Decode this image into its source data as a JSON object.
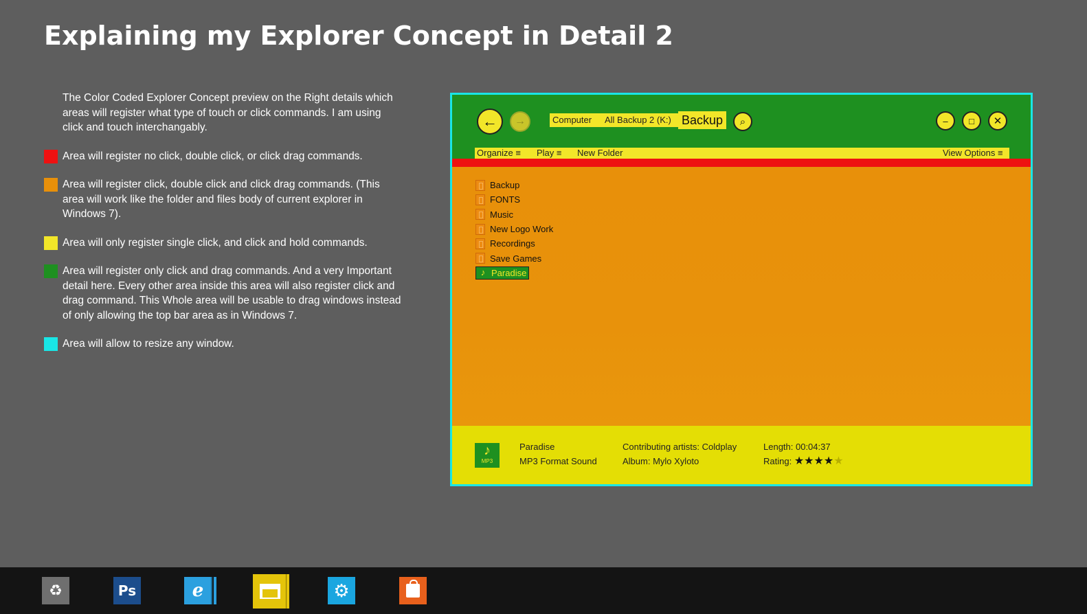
{
  "page": {
    "title": "Explaining my Explorer Concept in Detail 2"
  },
  "explanation": {
    "intro": "The Color Coded Explorer Concept preview on the Right details which areas will register what type of touch or click commands. I am using click and touch interchangably.",
    "legend": [
      {
        "color": "#ee1111",
        "text": "Area will register no click, double click, or click drag commands."
      },
      {
        "color": "#e8900a",
        "text": "Area will register click, double click and click drag commands. (This area will work like the folder and files body of current explorer in Windows 7)."
      },
      {
        "color": "#f2e629",
        "text": "Area will only register single click, and click and hold commands."
      },
      {
        "color": "#1e9020",
        "text": "Area will register only click and drag commands. And a very Important detail here. Every other area inside this area will also register click and drag command. This Whole area will be usable to drag windows instead of only allowing the top bar area as in Windows 7."
      },
      {
        "color": "#19e6e6",
        "text": "Area will allow to resize any window."
      }
    ]
  },
  "explorer": {
    "nav": {
      "back_icon": "arrow-left-icon",
      "forward_icon": "arrow-right-icon",
      "search_icon": "search-icon"
    },
    "breadcrumb": [
      "Computer",
      "All Backup 2 (K:)"
    ],
    "current_location": "Backup",
    "window_controls": {
      "minimize": "–",
      "maximize": "□",
      "close": "✕"
    },
    "commands": {
      "organize": "Organize ≡",
      "play": "Play ≡",
      "new_folder": "New Folder",
      "view_options": "View Options ≡"
    },
    "files": [
      {
        "name": "Backup",
        "type": "folder"
      },
      {
        "name": "FONTS",
        "type": "folder"
      },
      {
        "name": "Music",
        "type": "folder"
      },
      {
        "name": "New Logo Work",
        "type": "folder"
      },
      {
        "name": "Recordings",
        "type": "folder"
      },
      {
        "name": "Save Games",
        "type": "folder"
      },
      {
        "name": "Paradise",
        "type": "music",
        "selected": true
      }
    ],
    "details": {
      "icon_label": "MP3",
      "file_name": "Paradise",
      "file_type": "MP3 Format Sound",
      "artists": "Contributing artists: Coldplay",
      "album": "Album: Mylo Xyloto",
      "length": "Length: 00:04:37",
      "rating_label": "Rating:",
      "rating_value": 4,
      "rating_max": 5
    }
  },
  "taskbar": {
    "items": [
      {
        "name": "recycle-bin",
        "label": "♻"
      },
      {
        "name": "photoshop",
        "label": "Ps"
      },
      {
        "name": "internet-explorer",
        "label": "e"
      },
      {
        "name": "file-explorer",
        "label": ""
      },
      {
        "name": "settings",
        "label": "⚙"
      },
      {
        "name": "store",
        "label": ""
      }
    ]
  },
  "colors": {
    "background": "#5e5e5e",
    "green": "#1e9020",
    "yellow": "#f2e629",
    "orange": "#e8900a",
    "red": "#ee1111",
    "cyan": "#19e6e6"
  }
}
